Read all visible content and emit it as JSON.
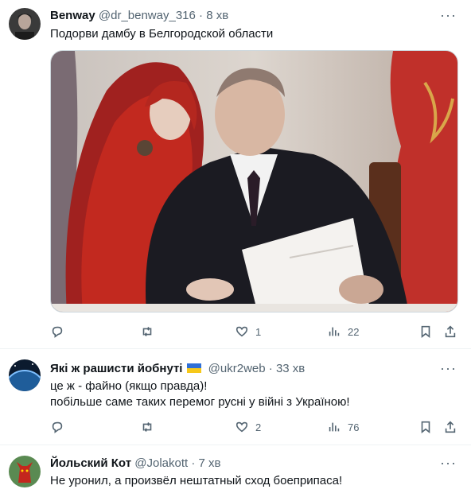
{
  "tweets": [
    {
      "name": "Benway",
      "handle": "@dr_benway_316",
      "time": "8 хв",
      "text_lines": [
        "Подорви дамбу в Белгородской области"
      ],
      "stats": {
        "replies": "",
        "retweets": "",
        "likes": "1",
        "views": "22"
      }
    },
    {
      "name": "Які ж рашисти йобнуті",
      "handle": "@ukr2web",
      "time": "33 хв",
      "text_lines": [
        "це ж - файно (якщо правда)!",
        "побільше саме таких перемог русні у війні з Україною!"
      ],
      "stats": {
        "replies": "",
        "retweets": "",
        "likes": "2",
        "views": "76"
      }
    },
    {
      "name": "Йольский Кот",
      "handle": "@Jolakott",
      "time": "7 хв",
      "text_lines": [
        "Не уронил, а произвёл нештатный сход боеприпаса!"
      ]
    }
  ],
  "separator": " · ",
  "more_glyph": "···",
  "colors": {
    "secondary_text": "#536471",
    "divider": "#eff3f4",
    "flag_blue": "#2f6fd6",
    "flag_yellow": "#f6c81a"
  },
  "icons": [
    "reply-icon",
    "retweet-icon",
    "like-icon",
    "views-icon",
    "bookmark-icon",
    "share-icon",
    "more-icon",
    "flag-ukraine-icon"
  ]
}
